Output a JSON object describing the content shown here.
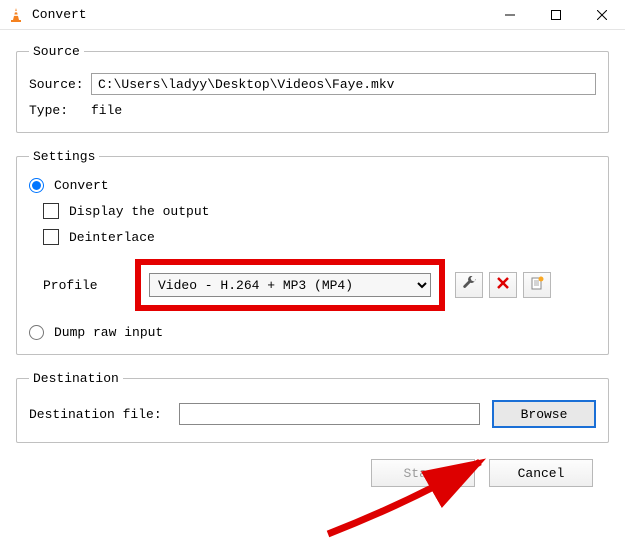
{
  "titlebar": {
    "title": "Convert"
  },
  "source": {
    "legend": "Source",
    "source_label": "Source:",
    "source_value": "C:\\Users\\ladyy\\Desktop\\Videos\\Faye.mkv",
    "type_label": "Type:",
    "type_value": "file"
  },
  "settings": {
    "legend": "Settings",
    "convert_label": "Convert",
    "display_output_label": "Display the output",
    "deinterlace_label": "Deinterlace",
    "profile_label": "Profile",
    "profile_selected": "Video - H.264 + MP3 (MP4)",
    "dump_raw_label": "Dump raw input"
  },
  "destination": {
    "legend": "Destination",
    "dest_label": "Destination file:",
    "dest_value": "",
    "browse_label": "Browse"
  },
  "footer": {
    "start_label": "Start",
    "cancel_label": "Cancel"
  }
}
